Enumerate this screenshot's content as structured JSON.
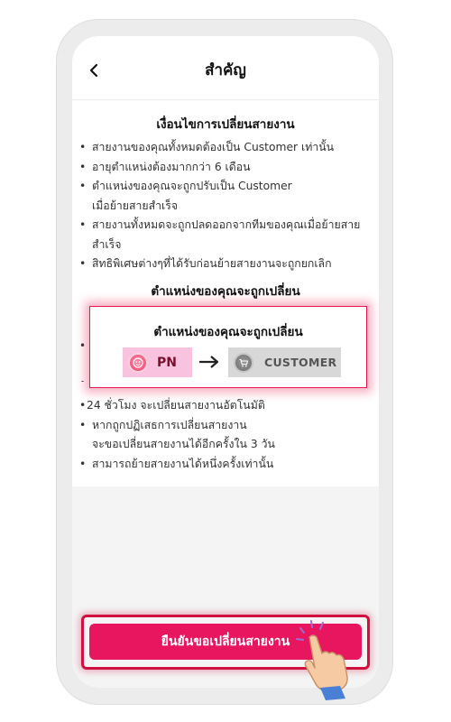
{
  "header": {
    "title": "สำคัญ",
    "back_icon": "chevron-left-icon"
  },
  "conditions": {
    "title": "เงื่อนไขการเปลี่ยนสายงาน",
    "items": [
      "สายงานของคุณทั้งหมดต้องเป็น Customer เท่านั้น",
      "อายุตำแหน่งต้องมากกว่า 6 เดือน",
      "ตำแหน่งของคุณจะถูกปรับเป็น Customer\nเมื่อย้ายสายสำเร็จ",
      "สายงานทั้งหมดจะถูกปลดออกจากทีมของคุณเมื่อย้ายสาย\nสำเร็จ",
      "สิทธิพิเศษต่างๆที่ได้รับก่อนย้ายสายงานจะถูกยกเลิก"
    ]
  },
  "position_section": {
    "title": "ตำแหน่งของคุณจะถูกเปลี่ยน"
  },
  "more_items": [
    "24 ชั่วโมง จะเปลี่ยนสายงานอัตโนมัติ",
    "หากถูกปฏิเสธการเปลี่ยนสายงาน\nจะขอเปลี่ยนสายงานได้อีกครั้งใน 3 วัน",
    "สามารถย้ายสายงานได้หนึ่งครั้งเท่านั้น"
  ],
  "popup": {
    "title": "ตำแหน่งของคุณจะถูกเปลี่ยน",
    "from_label": "PN",
    "to_label": "CUSTOMER",
    "from_color": "#f9c2de",
    "to_color": "#d8d8d8"
  },
  "confirm_button": {
    "label": "ยืนยันขอเปลี่ยนสายงาน",
    "color": "#e8155f"
  }
}
